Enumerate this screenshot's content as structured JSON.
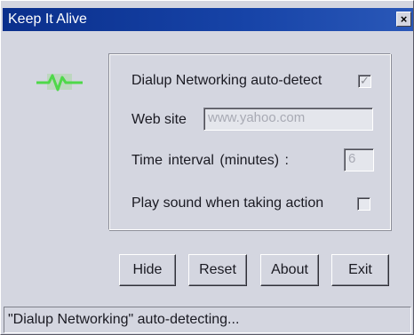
{
  "window": {
    "title": "Keep It Alive",
    "close_glyph": "×"
  },
  "icon": {
    "name": "heartbeat-monitor-icon",
    "color": "#4fd84a"
  },
  "settings": {
    "dialup_label": "Dialup Networking auto-detect",
    "dialup_checked": true,
    "website_label": "Web site",
    "website_value": "www.yahoo.com",
    "interval_label": "Time  interval  (minutes)  :",
    "interval_value": "6",
    "sound_label": "Play sound when taking action",
    "sound_checked": false,
    "check_glyph": "✓"
  },
  "buttons": {
    "hide": "Hide",
    "reset": "Reset",
    "about": "About",
    "exit": "Exit"
  },
  "status": {
    "text": "\"Dialup Networking\" auto-detecting..."
  },
  "colors": {
    "titlebar": "#0a2f8c",
    "face": "#d4d6e0"
  }
}
